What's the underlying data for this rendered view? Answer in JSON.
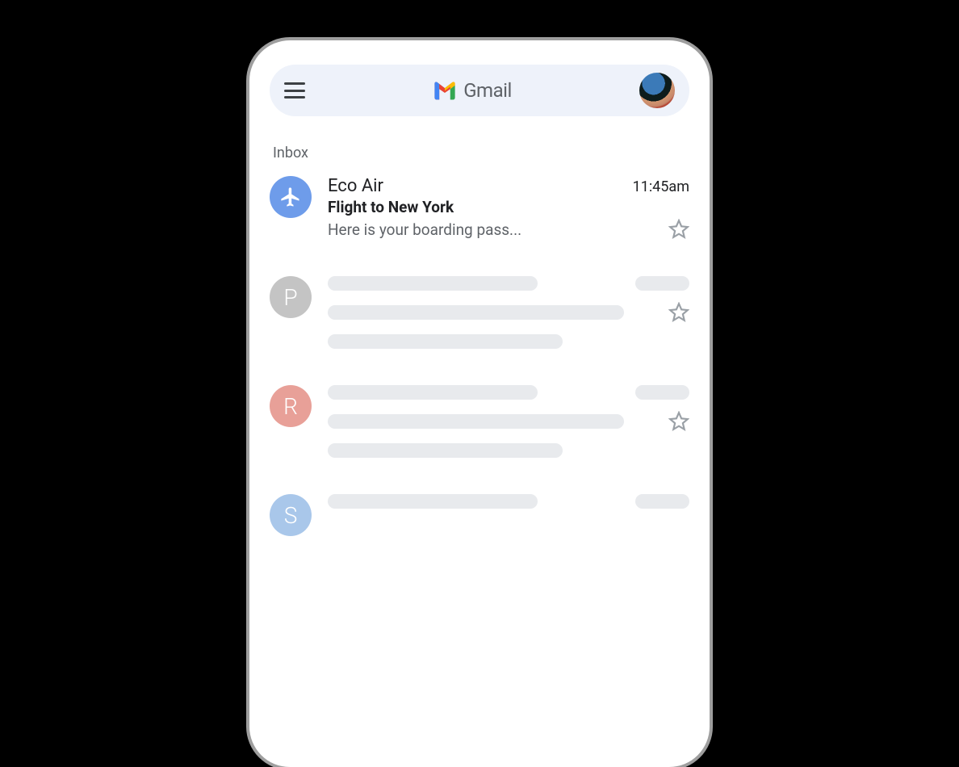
{
  "header": {
    "app_name": "Gmail"
  },
  "inbox": {
    "section_label": "Inbox",
    "emails": [
      {
        "sender": "Eco Air",
        "subject": "Flight to New York",
        "snippet": "Here is your boarding pass...",
        "time": "11:45am",
        "avatar_icon": "airplane",
        "avatar_color": "blue"
      }
    ],
    "placeholders": [
      {
        "avatar_letter": "P",
        "avatar_color": "gray"
      },
      {
        "avatar_letter": "R",
        "avatar_color": "pink"
      },
      {
        "avatar_letter": "S",
        "avatar_color": "lightblue"
      }
    ]
  }
}
